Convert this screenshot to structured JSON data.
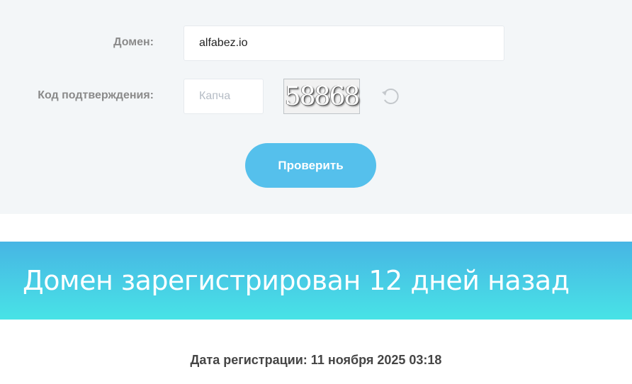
{
  "form": {
    "domain_label": "Домен:",
    "domain_value": "alfabez.io",
    "captcha_label": "Код подтверждения:",
    "captcha_placeholder": "Капча",
    "captcha_image_text": "58868",
    "refresh_icon": "refresh-icon",
    "submit_label": "Проверить",
    "button_color": "#55c0ec"
  },
  "result": {
    "headline": "Домен зарегистрирован 12 дней назад",
    "registration_date": "Дата регистрации: 11 ноября 2025 03:18"
  }
}
